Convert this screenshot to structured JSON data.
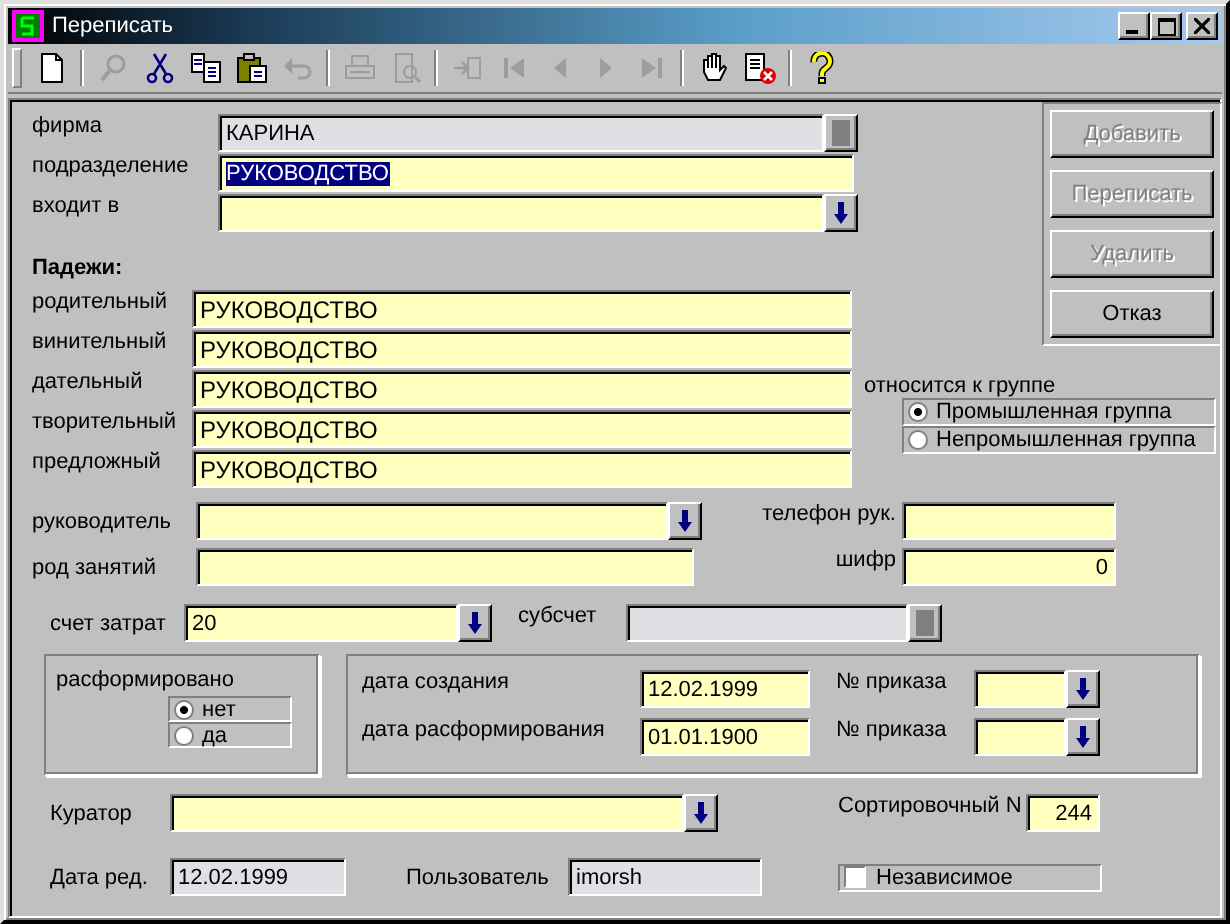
{
  "window": {
    "title": "Переписать"
  },
  "toolbar": [
    {
      "buttons": [
        {
          "kind": "new",
          "disabled": false
        }
      ]
    },
    {
      "buttons": [
        {
          "kind": "find",
          "disabled": true
        },
        {
          "kind": "cut",
          "disabled": false
        },
        {
          "kind": "copy",
          "disabled": false
        },
        {
          "kind": "paste",
          "disabled": false
        },
        {
          "kind": "undo",
          "disabled": true
        }
      ]
    },
    {
      "buttons": [
        {
          "kind": "print",
          "disabled": true
        },
        {
          "kind": "preview",
          "disabled": true
        }
      ]
    },
    {
      "buttons": [
        {
          "kind": "import",
          "disabled": true
        },
        {
          "kind": "first",
          "disabled": true
        },
        {
          "kind": "prev",
          "disabled": true
        },
        {
          "kind": "next",
          "disabled": true
        },
        {
          "kind": "last",
          "disabled": true
        }
      ]
    },
    {
      "buttons": [
        {
          "kind": "hand",
          "disabled": false
        },
        {
          "kind": "delete",
          "disabled": false
        }
      ]
    },
    {
      "buttons": [
        {
          "kind": "help",
          "disabled": false
        }
      ]
    }
  ],
  "top_fields": [
    {
      "label": "фирма",
      "value": "КАРИНА",
      "kind": "lookup",
      "readonly": true
    },
    {
      "label": "подразделение",
      "value": "РУКОВОДСТВО",
      "highlighted": true
    },
    {
      "label": "входит в",
      "kind": "dropdown"
    }
  ],
  "cases": {
    "heading": "Падежи:",
    "rows": [
      {
        "label": "родительный",
        "value": "РУКОВОДСТВО"
      },
      {
        "label": "винительный",
        "value": "РУКОВОДСТВО"
      },
      {
        "label": "дательный",
        "value": "РУКОВОДСТВО"
      },
      {
        "label": "творительный",
        "value": "РУКОВОДСТВО"
      },
      {
        "label": "предложный",
        "value": "РУКОВОДСТВО"
      }
    ]
  },
  "actions": [
    {
      "label": "Добавить",
      "disabled": true
    },
    {
      "label": "Переписать",
      "disabled": true
    },
    {
      "label": "Удалить",
      "disabled": true
    },
    {
      "label": "Отказ",
      "disabled": false
    }
  ],
  "group": {
    "label": "относится к группе",
    "options": [
      {
        "label": "Промышленная группа",
        "selected": true
      },
      {
        "label": "Непромышленная группа",
        "selected": false
      }
    ]
  },
  "manager": {
    "label": "руководитель",
    "kind": "dropdown"
  },
  "manager_phone": {
    "label": "телефон рук."
  },
  "occupation": {
    "label": "род занятий"
  },
  "code": {
    "label": "шифр",
    "value": "0",
    "kind": "number"
  },
  "cost_account": {
    "label": "счет затрат",
    "value": "20",
    "kind": "dropdown"
  },
  "subaccount": {
    "label": "субсчет",
    "kind": "lookup",
    "readonly": true
  },
  "disbanded": {
    "label": "расформировано",
    "options": [
      {
        "label": "нет",
        "selected": true
      },
      {
        "label": "да",
        "selected": false
      }
    ]
  },
  "dates": [
    {
      "label": "дата создания",
      "value": "12.02.1999",
      "order_label": "№ приказа"
    },
    {
      "label": "дата расформирования",
      "value": "01.01.1900",
      "order_label": "№ приказа"
    }
  ],
  "curator": {
    "label": "Куратор",
    "kind": "dropdown"
  },
  "sort_number": {
    "label": "Сортировочный N",
    "value": "244",
    "kind": "number"
  },
  "edit_date": {
    "label": "Дата ред.",
    "value": "12.02.1999",
    "readonly": true
  },
  "user": {
    "label": "Пользователь",
    "value": "imorsh",
    "readonly": true
  },
  "independent": {
    "label": "Независимое",
    "checked": false
  }
}
